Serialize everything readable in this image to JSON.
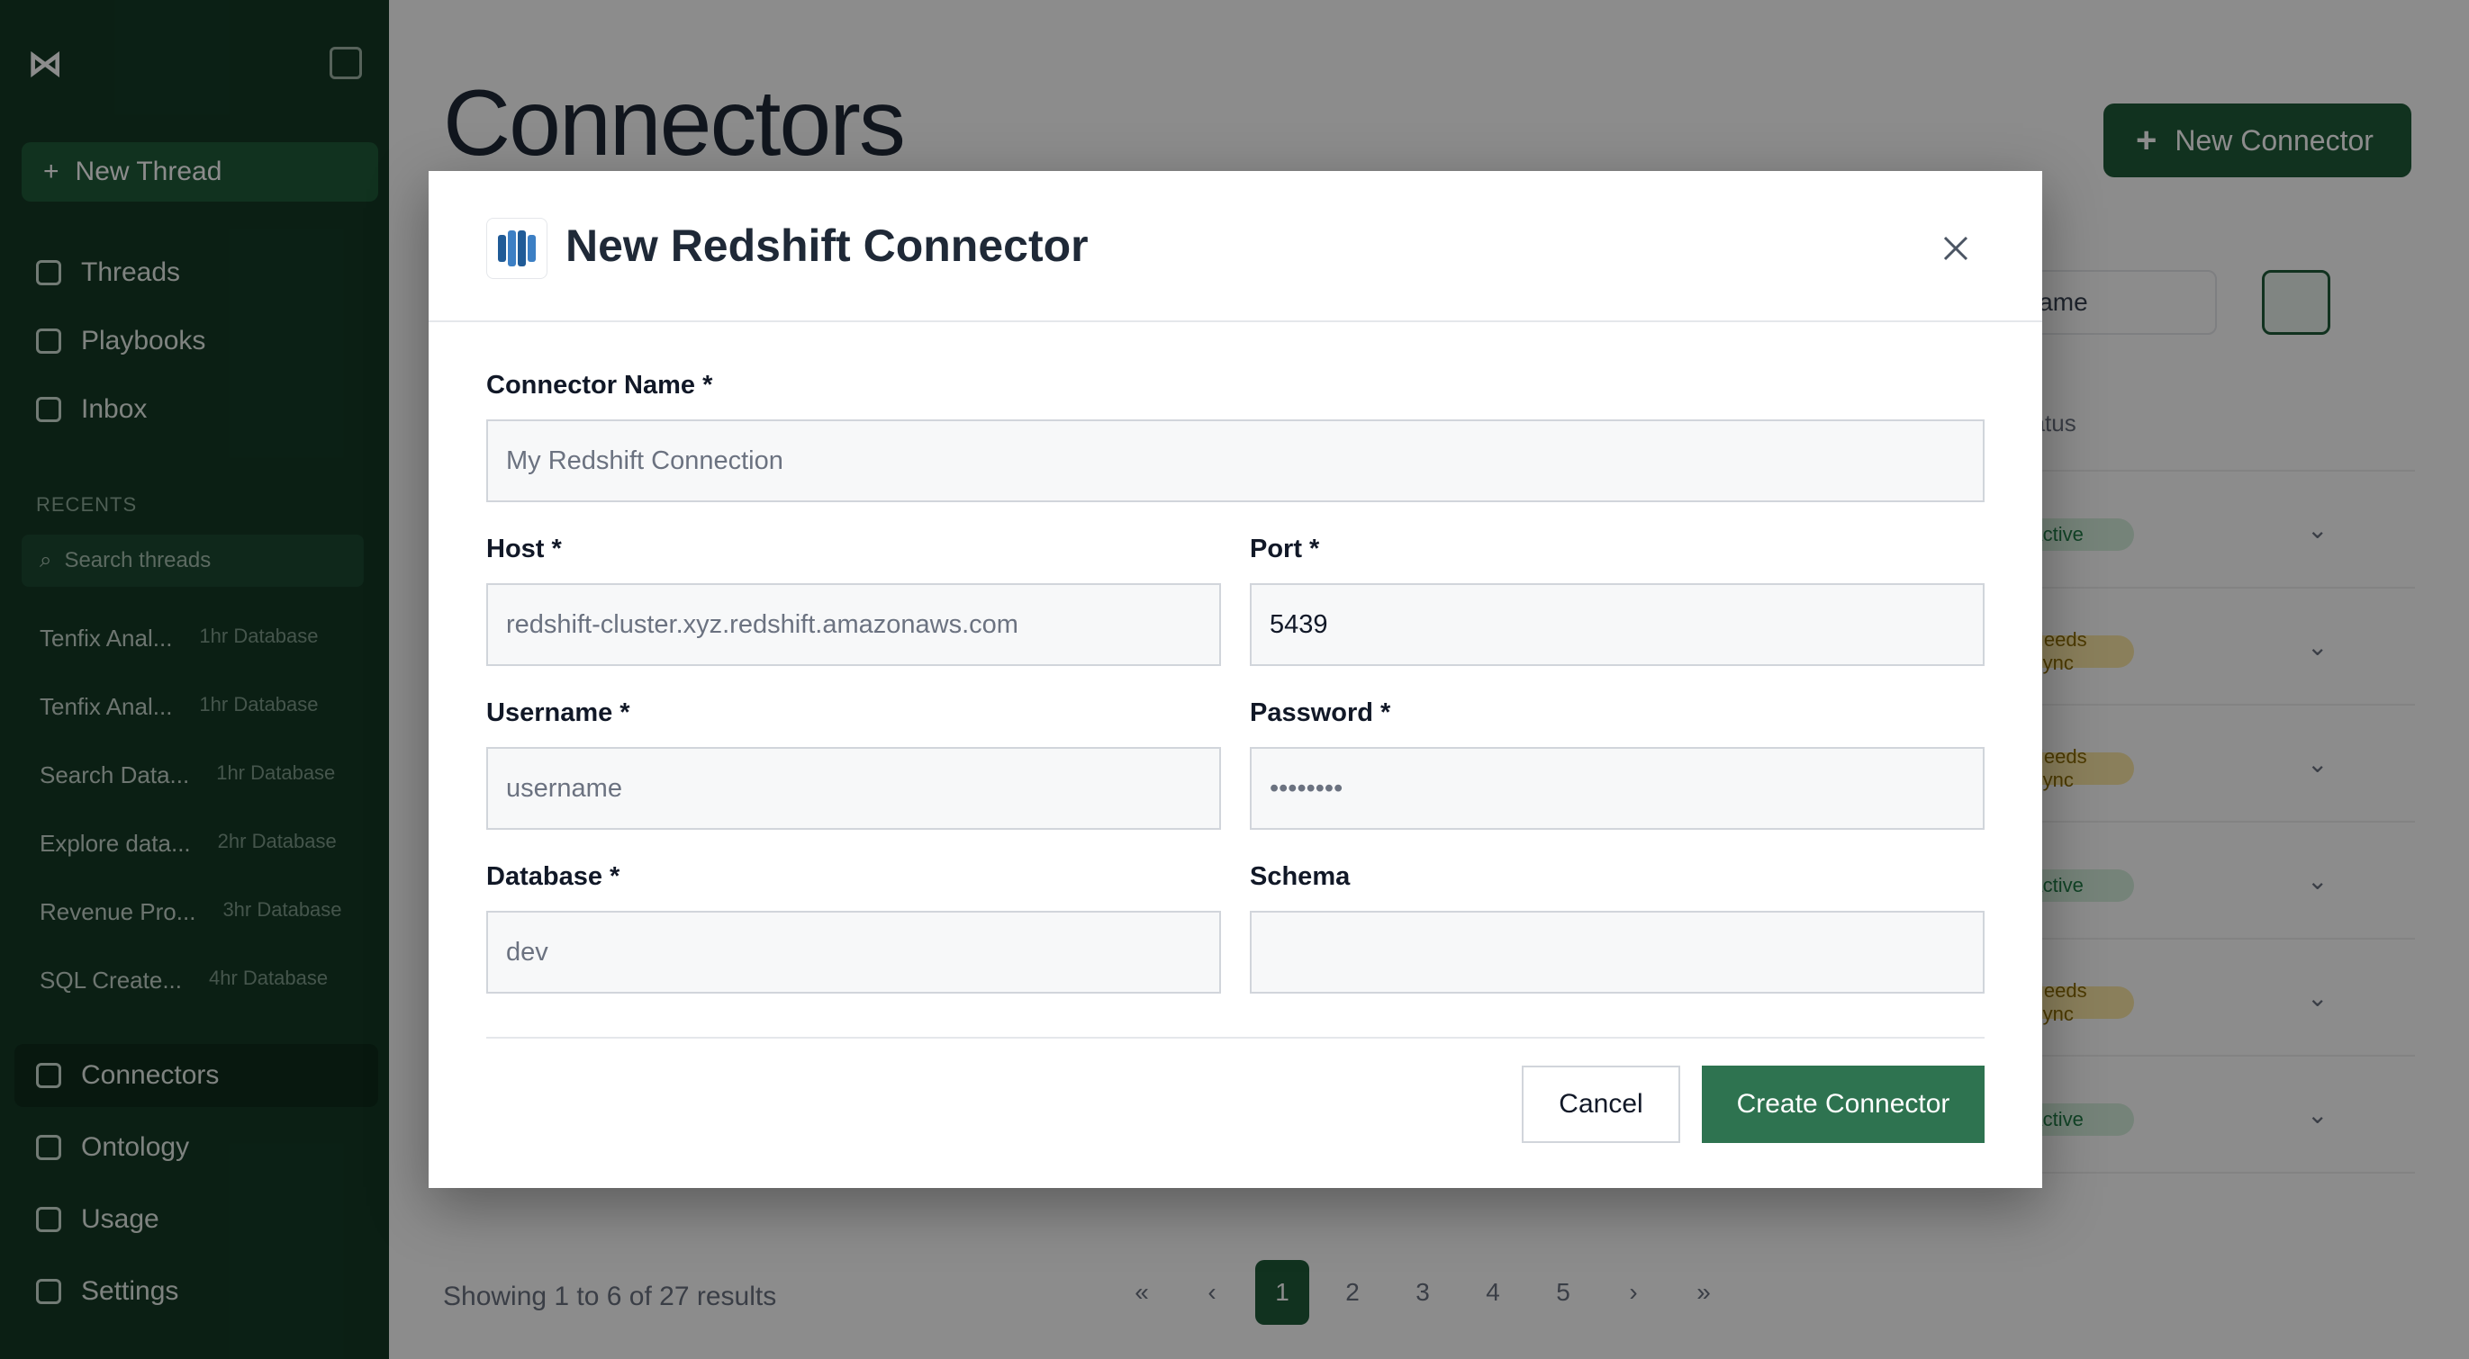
{
  "sidebar": {
    "new_thread": "New Thread",
    "nav": [
      "Threads",
      "Playbooks",
      "Inbox"
    ],
    "recents_label": "RECENTS",
    "search_placeholder": "Search threads",
    "recents": [
      {
        "title": "Tenfix Anal...",
        "meta": "1hr Database"
      },
      {
        "title": "Tenfix Anal...",
        "meta": "1hr Database"
      },
      {
        "title": "Search Data...",
        "meta": "1hr Database"
      },
      {
        "title": "Explore data...",
        "meta": "2hr Database"
      },
      {
        "title": "Revenue Pro...",
        "meta": "3hr Database"
      },
      {
        "title": "SQL Create...",
        "meta": "4hr Database"
      }
    ],
    "bottom_nav": [
      "Connectors",
      "Ontology",
      "Usage",
      "Settings"
    ]
  },
  "main": {
    "page_title": "Connectors",
    "new_connector": "New Connector",
    "sort_label": "Name",
    "table_status_header": "Status",
    "rows": [
      {
        "status": "Active",
        "kind": "ok"
      },
      {
        "status": "Needs Sync",
        "kind": "warn"
      },
      {
        "status": "Needs Sync",
        "kind": "warn"
      },
      {
        "status": "Active",
        "kind": "ok"
      },
      {
        "status": "Needs Sync",
        "kind": "warn"
      },
      {
        "status": "Active",
        "kind": "ok"
      }
    ],
    "pager_info": "Showing 1 to 6 of 27 results",
    "pages": [
      "«",
      "‹",
      "1",
      "2",
      "3",
      "4",
      "5",
      "›",
      "»"
    ],
    "active_page": "1"
  },
  "modal": {
    "title": "New Redshift Connector",
    "icon": "redshift-icon",
    "fields": {
      "connector_name": {
        "label": "Connector Name *",
        "placeholder": "My Redshift Connection",
        "value": ""
      },
      "host": {
        "label": "Host *",
        "placeholder": "redshift-cluster.xyz.redshift.amazonaws.com",
        "value": ""
      },
      "port": {
        "label": "Port *",
        "placeholder": "",
        "value": "5439"
      },
      "username": {
        "label": "Username *",
        "placeholder": "username",
        "value": ""
      },
      "password": {
        "label": "Password *",
        "placeholder": "••••••••",
        "value": ""
      },
      "database": {
        "label": "Database *",
        "placeholder": "dev",
        "value": ""
      },
      "schema": {
        "label": "Schema",
        "placeholder": "",
        "value": ""
      }
    },
    "cancel_label": "Cancel",
    "create_label": "Create Connector"
  },
  "colors": {
    "primary": "#2e7350",
    "sidebar": "#143a26",
    "overlay": "rgba(0,0,0,0.45)"
  }
}
